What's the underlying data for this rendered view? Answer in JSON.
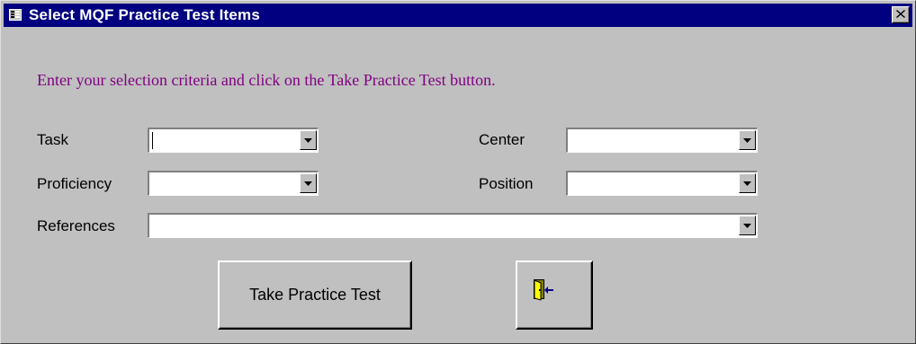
{
  "window": {
    "title": "Select MQF Practice Test Items",
    "system_icon": "form-icon",
    "close_icon": "close-icon"
  },
  "form": {
    "instruction": "Enter your selection criteria and click on the Take Practice Test button.",
    "instruction_color": "#800080",
    "fields": {
      "task": {
        "label": "Task",
        "value": ""
      },
      "proficiency": {
        "label": "Proficiency",
        "value": ""
      },
      "references": {
        "label": "References",
        "value": ""
      },
      "center": {
        "label": "Center",
        "value": ""
      },
      "position": {
        "label": "Position",
        "value": ""
      }
    },
    "dropdown_icon": "chevron-down-icon"
  },
  "buttons": {
    "take_test_label": "Take Practice Test",
    "exit_icon": "exit-door-icon"
  },
  "colors": {
    "titlebar": "#000080",
    "face": "#c0c0c0"
  }
}
